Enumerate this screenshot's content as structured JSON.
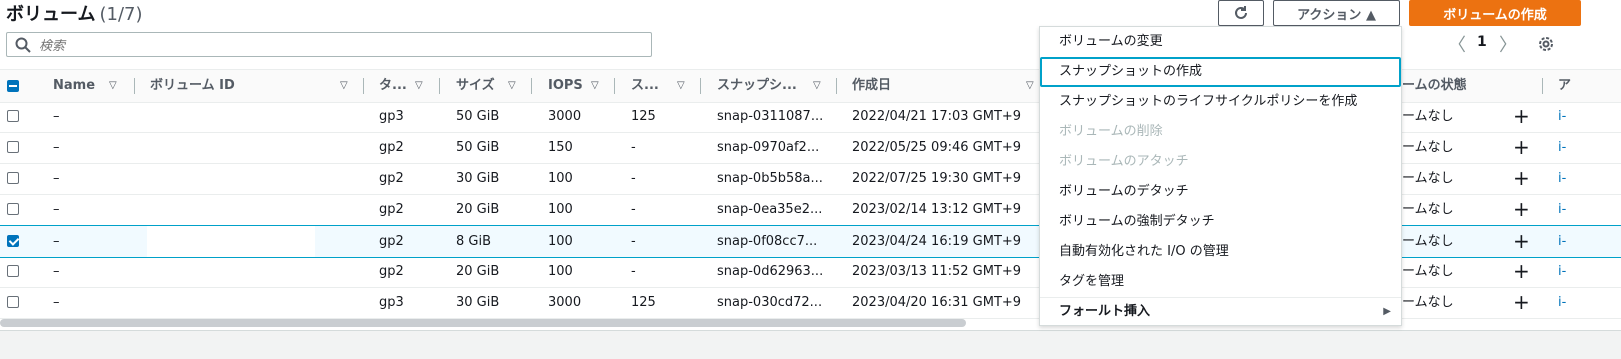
{
  "header": {
    "title": "ボリューム",
    "count": "(1/7)",
    "refresh_icon": "refresh-icon",
    "actions_label": "アクション ▲",
    "create_label": "ボリュームの作成"
  },
  "search": {
    "placeholder": "検索",
    "icon": "search-icon"
  },
  "pagination": {
    "prev": "〈",
    "page": "1",
    "next": "〉",
    "settings_icon": "gear-icon"
  },
  "columns": [
    "Name",
    "ボリューム ID",
    "タ...",
    "サイズ",
    "IOPS",
    "ス...",
    "スナップシ...",
    "作成日",
    "ームの状態",
    "ア"
  ],
  "rows": [
    {
      "checked": false,
      "name": "–",
      "type": "gp3",
      "size": "50 GiB",
      "iops": "3000",
      "throughput": "125",
      "snapshot": "snap-0311087...",
      "created": "2022/04/21 17:03 GMT+9",
      "state": "ームなし",
      "attached": "i-"
    },
    {
      "checked": false,
      "name": "–",
      "type": "gp2",
      "size": "50 GiB",
      "iops": "150",
      "throughput": "-",
      "snapshot": "snap-0970af2...",
      "created": "2022/05/25 09:46 GMT+9",
      "state": "ームなし",
      "attached": "i-"
    },
    {
      "checked": false,
      "name": "–",
      "type": "gp2",
      "size": "30 GiB",
      "iops": "100",
      "throughput": "-",
      "snapshot": "snap-0b5b58a...",
      "created": "2022/07/25 19:30 GMT+9",
      "state": "ームなし",
      "attached": "i-"
    },
    {
      "checked": false,
      "name": "–",
      "type": "gp2",
      "size": "20 GiB",
      "iops": "100",
      "throughput": "-",
      "snapshot": "snap-0ea35e2...",
      "created": "2023/02/14 13:12 GMT+9",
      "state": "ームなし",
      "attached": "i-"
    },
    {
      "checked": true,
      "name": "–",
      "type": "gp2",
      "size": "8 GiB",
      "iops": "100",
      "throughput": "-",
      "snapshot": "snap-0f08cc7...",
      "created": "2023/04/24 16:19 GMT+9",
      "state": "ームなし",
      "attached": "i-"
    },
    {
      "checked": false,
      "name": "–",
      "type": "gp2",
      "size": "20 GiB",
      "iops": "100",
      "throughput": "-",
      "snapshot": "snap-0d62963...",
      "created": "2023/03/13 11:52 GMT+9",
      "state": "ームなし",
      "attached": "i-"
    },
    {
      "checked": false,
      "name": "–",
      "type": "gp3",
      "size": "30 GiB",
      "iops": "3000",
      "throughput": "125",
      "snapshot": "snap-030cd72...",
      "created": "2023/04/20 16:31 GMT+9",
      "state": "ームなし",
      "attached": "i-"
    }
  ],
  "menu": {
    "items": [
      {
        "label": "ボリュームの変更",
        "state": "enabled"
      },
      {
        "label": "スナップショットの作成",
        "state": "focused"
      },
      {
        "label": "スナップショットのライフサイクルポリシーを作成",
        "state": "enabled"
      },
      {
        "label": "ボリュームの削除",
        "state": "disabled"
      },
      {
        "label": "ボリュームのアタッチ",
        "state": "disabled"
      },
      {
        "label": "ボリュームのデタッチ",
        "state": "enabled"
      },
      {
        "label": "ボリュームの強制デタッチ",
        "state": "enabled"
      },
      {
        "label": "自動有効化された I/O の管理",
        "state": "enabled"
      },
      {
        "label": "タグを管理",
        "state": "enabled"
      },
      {
        "label": "フォールト挿入",
        "state": "submenu"
      }
    ],
    "submenu_arrow": "▶"
  },
  "colors": {
    "primary": "#ec7211",
    "focus": "#00a1c9",
    "checkbox": "#0073bb"
  }
}
